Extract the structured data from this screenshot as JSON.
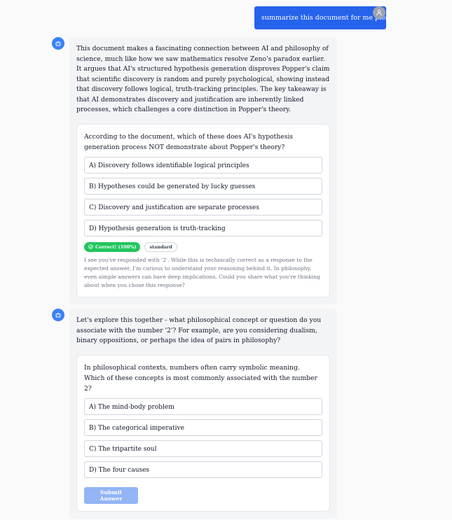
{
  "user_message": {
    "text": "summarize this document for me please",
    "avatar_icon": "user-icon"
  },
  "bot_icon": "robot-icon",
  "message1": {
    "text": "This document makes a fascinating connection between AI and philosophy of science, much like how we saw mathematics resolve Zeno's paradox earlier. It argues that AI's structured hypothesis generation disproves Popper's claim that scientific discovery is random and purely psychological, showing instead that discovery follows logical, truth-tracking principles. The key takeaway is that AI demonstrates discovery and justification are inherently linked processes, which challenges a core distinction in Popper's theory.",
    "quiz": {
      "question": "According to the document, which of these does AI's hypothesis generation process NOT demonstrate about Popper's theory?",
      "options": [
        "A) Discovery follows identifiable logical principles",
        "B) Hypotheses could be generated by lucky guesses",
        "C) Discovery and justification are separate processes",
        "D) Hypothesis generation is truth-tracking"
      ],
      "result_badge": "Correct! (100%)",
      "level_badge": "standard",
      "feedback": "I see you've responded with '2'. While this is technically correct as a response to the expected answer, I'm curious to understand your reasoning behind it. In philosophy, even simple answers can have deep implications. Could you share what you're thinking about when you chose this response?"
    }
  },
  "message2": {
    "text": "Let's explore this together - what philosophical concept or question do you associate with the number '2'? For example, are you considering dualism, binary oppositions, or perhaps the idea of pairs in philosophy?",
    "quiz": {
      "question": "In philosophical contexts, numbers often carry symbolic meaning. Which of these concepts is most commonly associated with the number 2?",
      "options": [
        "A) The mind-body problem",
        "B) The categorical imperative",
        "C) The tripartite soul",
        "D) The four causes"
      ],
      "submit_label": "Submit Answer"
    }
  },
  "colors": {
    "accent": "#2563eb",
    "bot_icon": "#3b82f6",
    "correct": "#22c55e",
    "submit_disabled": "#93b4f5"
  }
}
